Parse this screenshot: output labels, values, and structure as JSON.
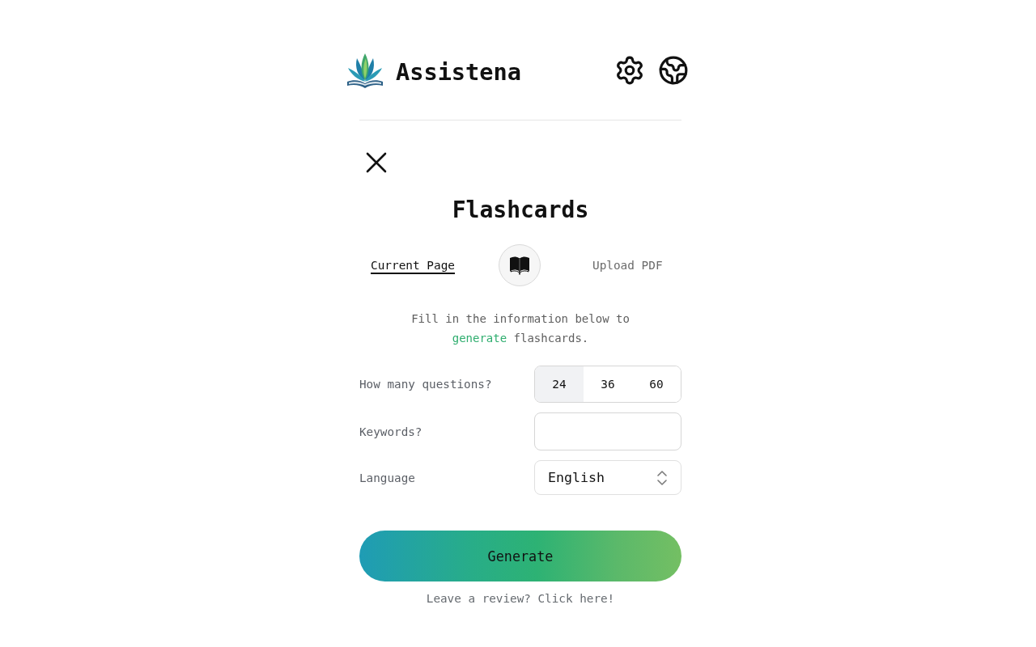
{
  "header": {
    "app_name": "Assistena"
  },
  "panel": {
    "title": "Flashcards"
  },
  "source_tabs": [
    {
      "label": "Current Page",
      "selected": true
    },
    {
      "label": "Upload PDF",
      "selected": false
    }
  ],
  "description": [
    {
      "text": "Fill in the information below to ",
      "highlight": false
    },
    {
      "text": "generate",
      "highlight": true
    },
    {
      "text": " flashcards.",
      "highlight": false
    }
  ],
  "fields": [
    {
      "kind": "choice",
      "label": "How many questions?",
      "options": [
        {
          "label": "24",
          "selected": true
        },
        {
          "label": "36",
          "selected": false
        },
        {
          "label": "60",
          "selected": false
        }
      ]
    },
    {
      "kind": "text",
      "label": "Keywords?"
    },
    {
      "kind": "select",
      "label": "Language",
      "value": "English"
    }
  ],
  "generate_button": {
    "label": "Generate"
  },
  "review_link": {
    "label": "Leave a review? Click here!"
  }
}
